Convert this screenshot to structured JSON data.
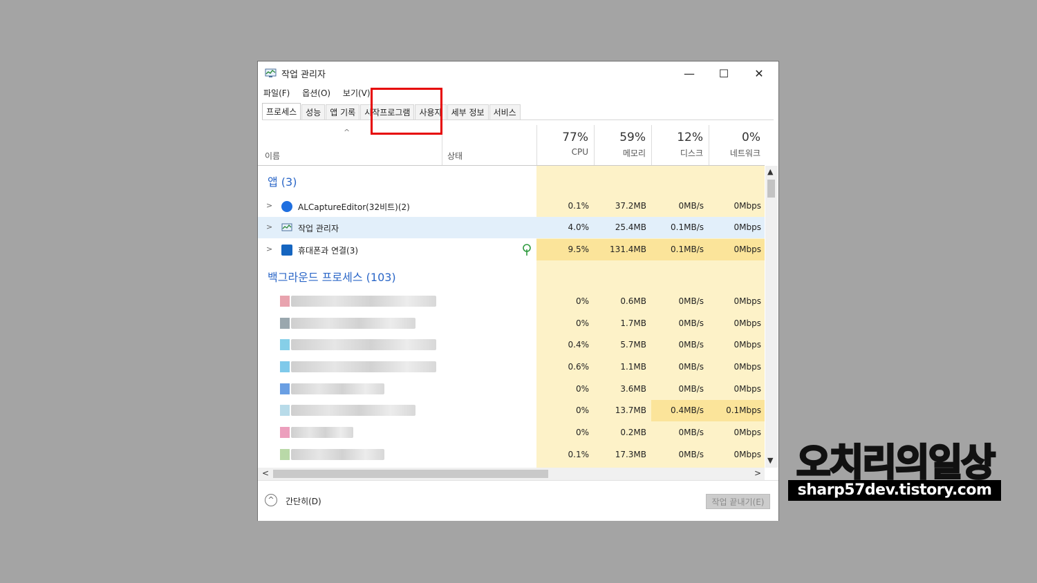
{
  "window": {
    "title": "작업 관리자",
    "controls": {
      "minimize": "—",
      "maximize": "☐",
      "close": "✕"
    }
  },
  "menu": [
    "파일(F)",
    "옵션(O)",
    "보기(V)"
  ],
  "tabs": [
    "프로세스",
    "성능",
    "앱 기록",
    "시작프로그램",
    "사용자",
    "세부 정보",
    "서비스"
  ],
  "active_tab": "프로세스",
  "highlighted_tab": "시작프로그램",
  "columns": {
    "name": "이름",
    "status": "상태",
    "cpu": {
      "percent": "77%",
      "label": "CPU"
    },
    "memory": {
      "percent": "59%",
      "label": "메모리"
    },
    "disk": {
      "percent": "12%",
      "label": "디스크"
    },
    "network": {
      "percent": "0%",
      "label": "네트워크"
    }
  },
  "groups": {
    "apps": "앱 (3)",
    "background": "백그라운드 프로세스 (103)"
  },
  "apps": [
    {
      "name": "ALCaptureEditor(32비트)(2)",
      "cpu": "0.1%",
      "memory": "37.2MB",
      "disk": "0MB/s",
      "network": "0Mbps"
    },
    {
      "name": "작업 관리자",
      "cpu": "4.0%",
      "memory": "25.4MB",
      "disk": "0.1MB/s",
      "network": "0Mbps"
    },
    {
      "name": "휴대폰과 연결(3)",
      "cpu": "9.5%",
      "memory": "131.4MB",
      "disk": "0.1MB/s",
      "network": "0Mbps"
    }
  ],
  "background": [
    {
      "cpu": "0%",
      "memory": "0.6MB",
      "disk": "0MB/s",
      "network": "0Mbps"
    },
    {
      "cpu": "0%",
      "memory": "1.7MB",
      "disk": "0MB/s",
      "network": "0Mbps"
    },
    {
      "cpu": "0.4%",
      "memory": "5.7MB",
      "disk": "0MB/s",
      "network": "0Mbps"
    },
    {
      "cpu": "0.6%",
      "memory": "1.1MB",
      "disk": "0MB/s",
      "network": "0Mbps"
    },
    {
      "cpu": "0%",
      "memory": "3.6MB",
      "disk": "0MB/s",
      "network": "0Mbps"
    },
    {
      "cpu": "0%",
      "memory": "13.7MB",
      "disk": "0.4MB/s",
      "network": "0.1Mbps"
    },
    {
      "cpu": "0%",
      "memory": "0.2MB",
      "disk": "0MB/s",
      "network": "0Mbps"
    },
    {
      "cpu": "0.1%",
      "memory": "17.3MB",
      "disk": "0MB/s",
      "network": "0Mbps"
    }
  ],
  "footer": {
    "less_details": "간단히(D)",
    "end_task": "작업 끝내기(E)"
  },
  "watermark": {
    "title": "오치리의일상",
    "url": "sharp57dev.tistory.com"
  },
  "colors": {
    "highlight_box": "#e60000",
    "group_text": "#2a66c7",
    "metric_bg": "#fdf2c8",
    "selected_row": "#e2effa"
  }
}
